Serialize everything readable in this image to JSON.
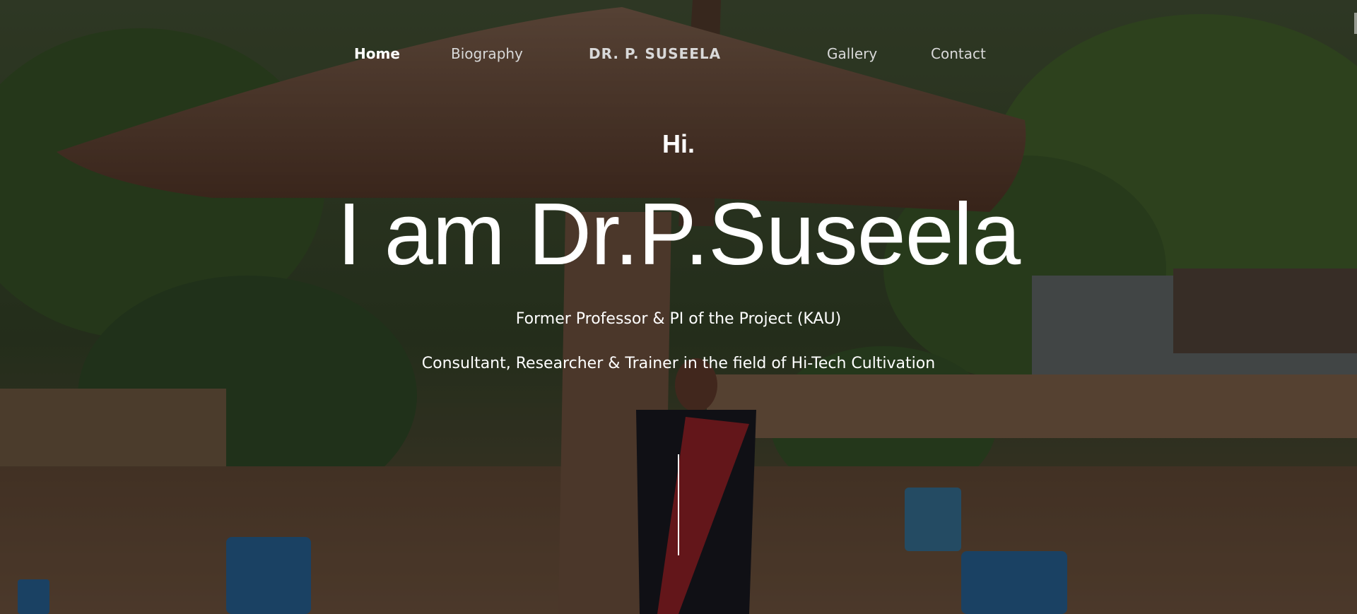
{
  "nav": {
    "home": "Home",
    "biography": "Biography",
    "brand": "DR. P. SUSEELA",
    "gallery": "Gallery",
    "contact": "Contact"
  },
  "hero": {
    "greeting": "Hi.",
    "headline": "I am Dr.P.Suseela",
    "subtitle_1": "Former Professor & PI of the Project (KAU)",
    "subtitle_2": "Consultant, Researcher & Trainer in the field of Hi-Tech Cultivation"
  },
  "colors": {
    "text": "#ffffff",
    "nav_inactive": "#d9d9d9",
    "overlay": "rgba(0,0,0,0.38)"
  },
  "icons": {
    "scroll_indicator": "vertical-line"
  }
}
